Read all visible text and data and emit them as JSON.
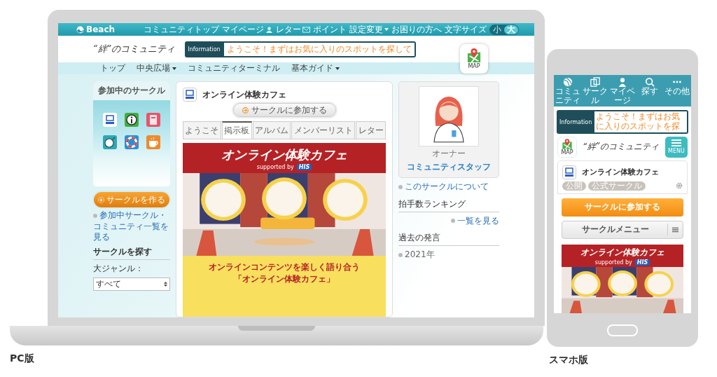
{
  "pc": {
    "caption": "PC版",
    "top_bar": {
      "brand": "Beach",
      "links": [
        {
          "label": "コミュニティトップ",
          "dropdown": false
        },
        {
          "label": "マイページ",
          "dropdown": false
        },
        {
          "label": "レター",
          "dropdown": false
        },
        {
          "label": "ポイント",
          "dropdown": false
        },
        {
          "label": "設定変更",
          "dropdown": true
        },
        {
          "label": "お困りの方へ",
          "dropdown": false
        }
      ],
      "font_size_label": "文字サイズ",
      "font_sizes": [
        {
          "label": "小",
          "selected": false
        },
        {
          "label": "大",
          "selected": true
        }
      ]
    },
    "logo": "“絆”のコミュニティ",
    "information": {
      "label": "Information",
      "text": "ようこそ！まずはお気に入りのスポットを探して"
    },
    "map_button": "MAP",
    "nav": [
      {
        "label": "トップ",
        "dropdown": false
      },
      {
        "label": "中央広場",
        "dropdown": true
      },
      {
        "label": "コミュニティターミナル",
        "dropdown": false
      },
      {
        "label": "基本ガイド",
        "dropdown": true
      }
    ],
    "left": {
      "title": "参加中のサークル",
      "create_button": "サークルを作る",
      "list_link": "参加中サークル・コミュニティ一覧を見る",
      "search_heading": "サークルを探す",
      "genre_label": "大ジャンル：",
      "genre_value": "すべて"
    },
    "circle": {
      "name": "オンライン体験カフェ",
      "join_button": "サークルに参加する",
      "tabs": [
        {
          "label": "ようこそ",
          "selected": false
        },
        {
          "label": "掲示板",
          "selected": true
        },
        {
          "label": "アルバム",
          "selected": false
        },
        {
          "label": "メンバーリスト",
          "selected": false
        },
        {
          "label": "レター",
          "selected": false
        }
      ],
      "banner": {
        "title": "オンライン体験カフェ",
        "supported_by": "supported by",
        "sponsor": "HIS",
        "tagline": "オンラインコンテンツを楽しく語り合う",
        "subtitle": "「オンライン体験カフェ」"
      }
    },
    "right": {
      "owner_role": "オーナー",
      "owner_name": "コミュニティスタッフ",
      "about_link": "このサークルについて",
      "ranking_heading": "拍手数ランキング",
      "ranking_link": "一覧を見る",
      "history_heading": "過去の発言",
      "history": [
        "2021年"
      ]
    }
  },
  "sp": {
    "caption": "スマホ版",
    "tabs": [
      {
        "label": "コミュニティ"
      },
      {
        "label": "サークル"
      },
      {
        "label": "マイページ"
      },
      {
        "label": "探す"
      },
      {
        "label": "その他"
      }
    ],
    "information": {
      "label": "Information",
      "text": "ようこそ！まずはお気に入りのスポットを探"
    },
    "map_button": "MAP",
    "logo": "“絆”のコミュニティ",
    "menu_button": "MENU",
    "circle": {
      "name": "オンライン体験カフェ",
      "tags": [
        "公開",
        "公式サークル"
      ],
      "join_button": "サークルに参加する",
      "menu_button": "サークルメニュー",
      "banner": {
        "title": "オンライン体験カフェ",
        "supported_by": "supported by",
        "sponsor": "HIS"
      }
    }
  }
}
